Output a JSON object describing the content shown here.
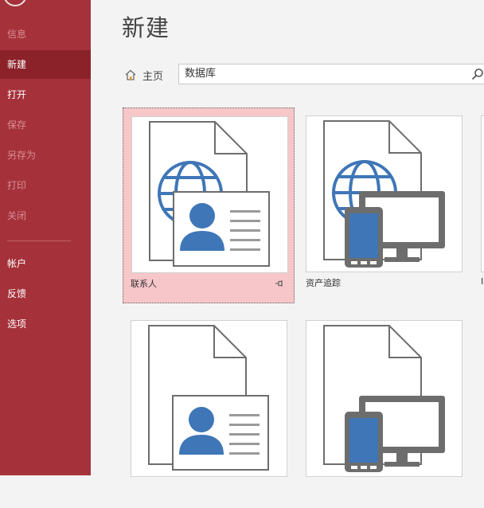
{
  "sidebar": {
    "items": [
      {
        "label": "信息",
        "state": "disabled"
      },
      {
        "label": "新建",
        "state": "selected"
      },
      {
        "label": "打开",
        "state": "normal"
      },
      {
        "label": "保存",
        "state": "disabled"
      },
      {
        "label": "另存为",
        "state": "disabled"
      },
      {
        "label": "打印",
        "state": "disabled"
      },
      {
        "label": "关闭",
        "state": "disabled"
      },
      {
        "label": "帐户",
        "state": "normal"
      },
      {
        "label": "反馈",
        "state": "normal"
      },
      {
        "label": "选项",
        "state": "normal"
      }
    ]
  },
  "main": {
    "title": "新建",
    "home_label": "主页",
    "search_value": "数据库",
    "templates": [
      {
        "label": "联系人",
        "icon": "contacts-template-icon",
        "selected": true
      },
      {
        "label": "资产追踪",
        "icon": "asset-tracking-template-icon",
        "selected": false
      },
      {
        "label": "",
        "icon": "contacts-template-icon",
        "selected": false
      },
      {
        "label": "",
        "icon": "asset-tracking-template-icon",
        "selected": false
      }
    ]
  },
  "colors": {
    "sidebar": "#a5323a",
    "sidebar_selected": "#8b2129",
    "tile_selected": "#f6c6c9",
    "icon_blue": "#3f76b7",
    "icon_gray": "#6d6d6d"
  }
}
